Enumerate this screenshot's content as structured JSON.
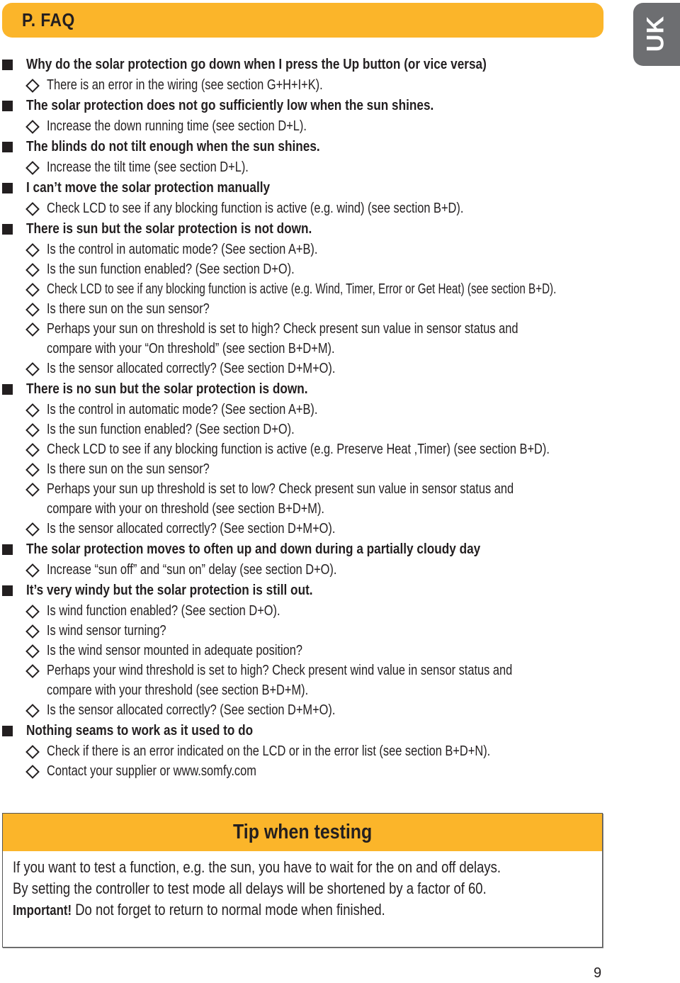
{
  "header": {
    "title": "P. FAQ",
    "language_tab": "UK",
    "accent_color": "#fbb52a",
    "tab_color": "#6d6e71"
  },
  "faq": [
    {
      "question": "Why do the solar protection go down when I press the Up button (or vice versa)",
      "answers": [
        "There is an error in the wiring (see section G+H+I+K)."
      ]
    },
    {
      "question": "The solar protection does not go sufficiently low when the sun shines.",
      "answers": [
        "Increase the down running time (see section D+L)."
      ]
    },
    {
      "question": "The blinds do not tilt enough when the sun shines.",
      "answers": [
        "Increase the tilt time (see section D+L)."
      ]
    },
    {
      "question": "I can’t move the solar protection manually",
      "answers": [
        "Check LCD to see if any blocking function is active (e.g. wind) (see section B+D)."
      ]
    },
    {
      "question": "There is sun but the solar protection is not down.",
      "answers": [
        "Is the control in automatic mode? (See section A+B).",
        "Is the sun function enabled? (See section D+O).",
        "Check LCD to see if any blocking function is active (e.g. Wind, Timer, Error or Get Heat) (see section B+D).",
        "Is there sun on the sun sensor?",
        "Perhaps your sun on threshold is set to high? Check present sun value in sensor status and",
        "compare with your “On threshold” (see section B+D+M).",
        "Is the sensor allocated correctly? (See section D+M+O)."
      ]
    },
    {
      "question": "There is no sun but the solar protection is down.",
      "answers": [
        "Is the control in automatic mode? (See section A+B).",
        "Is the sun function enabled? (See section D+O).",
        "Check LCD to see if any blocking function is active (e.g. Preserve Heat ,Timer) (see section B+D).",
        "Is there sun on the sun sensor?",
        "Perhaps your sun up threshold is set to low? Check present sun value in sensor status and",
        "compare with your on threshold (see section B+D+M).",
        "Is the sensor allocated correctly? (See section D+M+O)."
      ]
    },
    {
      "question": "The solar protection moves to often up and down during a partially cloudy day",
      "answers": [
        "Increase “sun off” and “sun on” delay (see section D+O)."
      ]
    },
    {
      "question": "It’s very windy but the solar protection is still out.",
      "answers": [
        "Is wind function enabled? (See section D+O).",
        "Is wind sensor turning?",
        "Is the wind sensor mounted in adequate position?",
        "Perhaps your wind threshold is set to high? Check present wind value in sensor status and",
        "compare with your threshold (see section B+D+M).",
        "Is the sensor allocated correctly? (See section D+M+O)."
      ]
    },
    {
      "question": "Nothing seams to work as it used to do",
      "answers": [
        "Check if there is an error indicated on the LCD or in the error list (see section B+D+N).",
        "Contact your supplier or www.somfy.com"
      ]
    }
  ],
  "tip": {
    "title": "Tip when testing",
    "line1": "If you want to test a function, e.g. the sun, you have to wait for the on and off delays.",
    "line2": "By setting the controller to test mode all delays will be shortened by a factor of 60.",
    "important_label": "Important!",
    "line3": " Do not forget to return to normal mode when finished."
  },
  "page_number": "9"
}
